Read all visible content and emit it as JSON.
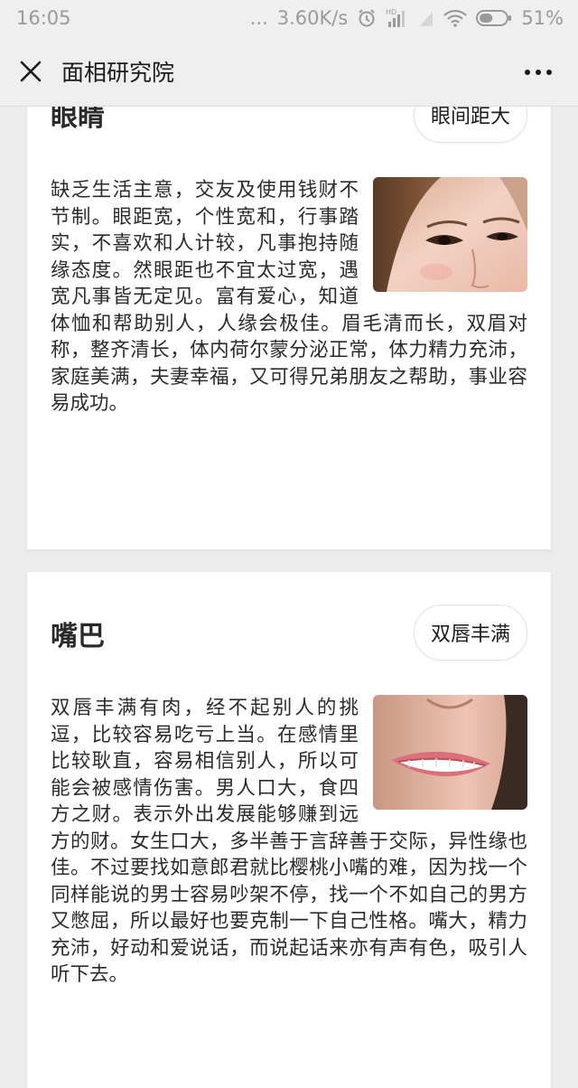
{
  "status_bar": {
    "time": "16:05",
    "dots": "...",
    "network_speed": "3.60K/s",
    "battery_percent": "51%",
    "battery_level": 0.51,
    "icons": [
      "alarm-icon",
      "hd-signal-icon",
      "wifi-icon",
      "battery-icon"
    ]
  },
  "nav": {
    "title": "面相研究院",
    "close_icon": "close-icon",
    "more_icon": "more-icon"
  },
  "cards": [
    {
      "title": "眼睛",
      "tag": "眼间距大",
      "photo": "eyes-photo",
      "text": "缺乏生活主意，交友及使用钱财不节制。眼距宽，个性宽和，行事踏实，不喜欢和人计较，凡事抱持随缘态度。然眼距也不宜太过宽，遇宽凡事皆无定见。富有爱心，知道体恤和帮助别人，人缘会极佳。眉毛清而长，双眉对称，整齐清长，体内荷尔蒙分泌正常，体力精力充沛，家庭美满，夫妻幸福，又可得兄弟朋友之帮助，事业容易成功。"
    },
    {
      "title": "嘴巴",
      "tag": "双唇丰满",
      "photo": "lips-photo",
      "text": "双唇丰满有肉，经不起别人的挑逗，比较容易吃亏上当。在感情里比较耿直，容易相信别人，所以可能会被感情伤害。男人口大，食四方之财。表示外出发展能够赚到远方的财。女生口大，多半善于言辞善于交际，异性缘也佳。不过要找如意郎君就比樱桃小嘴的难，因为找一个同样能说的男士容易吵架不停，找一个不如自己的男方又憋屈，所以最好也要克制一下自己性格。嘴大，精力充沛，好动和爱说话，而说起话来亦有声有色，吸引人听下去。"
    }
  ]
}
